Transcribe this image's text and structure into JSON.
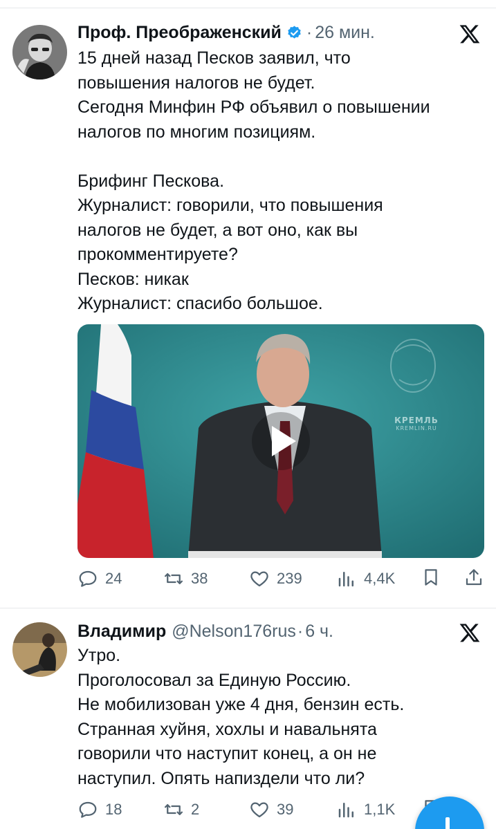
{
  "tweets": [
    {
      "author_name": "Проф. Преображенский",
      "verified": true,
      "separator": "·",
      "time": "26 мин.",
      "text_lines": [
        "15 дней назад Песков заявил, что",
        "повышения налогов не будет.",
        "Сегодня Минфин РФ объявил о повышении",
        "налогов по многим позициям.",
        "",
        "Брифинг Пескова.",
        "Журналист: говорили, что повышения",
        "налогов не будет, а вот оно, как вы",
        "прокомментируете?",
        "Песков: никак",
        "Журналист: спасибо большое."
      ],
      "video": {
        "watermark_line1": "КРЕМЛЬ",
        "watermark_line2": "KREMLIN.RU"
      },
      "stats": {
        "replies": "24",
        "retweets": "38",
        "likes": "239",
        "views": "4,4K"
      }
    },
    {
      "author_name": "Владимир",
      "handle": "@Nelson176rus",
      "separator": "·",
      "time": "6 ч.",
      "text_lines": [
        "Утро.",
        "Проголосовал за Единую Россию.",
        "Не мобилизован уже 4 дня, бензин есть.",
        "Странная хуйня, хохлы и навальнята",
        "говорили что наступит конец, а он не",
        "наступил. Опять напиздели что ли?"
      ],
      "stats": {
        "replies": "18",
        "retweets": "2",
        "likes": "39",
        "views": "1,1K"
      }
    }
  ],
  "icons": {
    "reply": "reply-icon",
    "retweet": "retweet-icon",
    "like": "heart-icon",
    "views": "views-icon",
    "bookmark": "bookmark-icon",
    "share": "share-icon",
    "x_logo": "x-logo-icon",
    "verified": "verified-badge-icon",
    "compose": "compose-plus-icon"
  },
  "colors": {
    "accent": "#1d9bf0",
    "secondary_text": "#536471",
    "primary_text": "#0f1419",
    "divider": "#e6e8ea"
  }
}
